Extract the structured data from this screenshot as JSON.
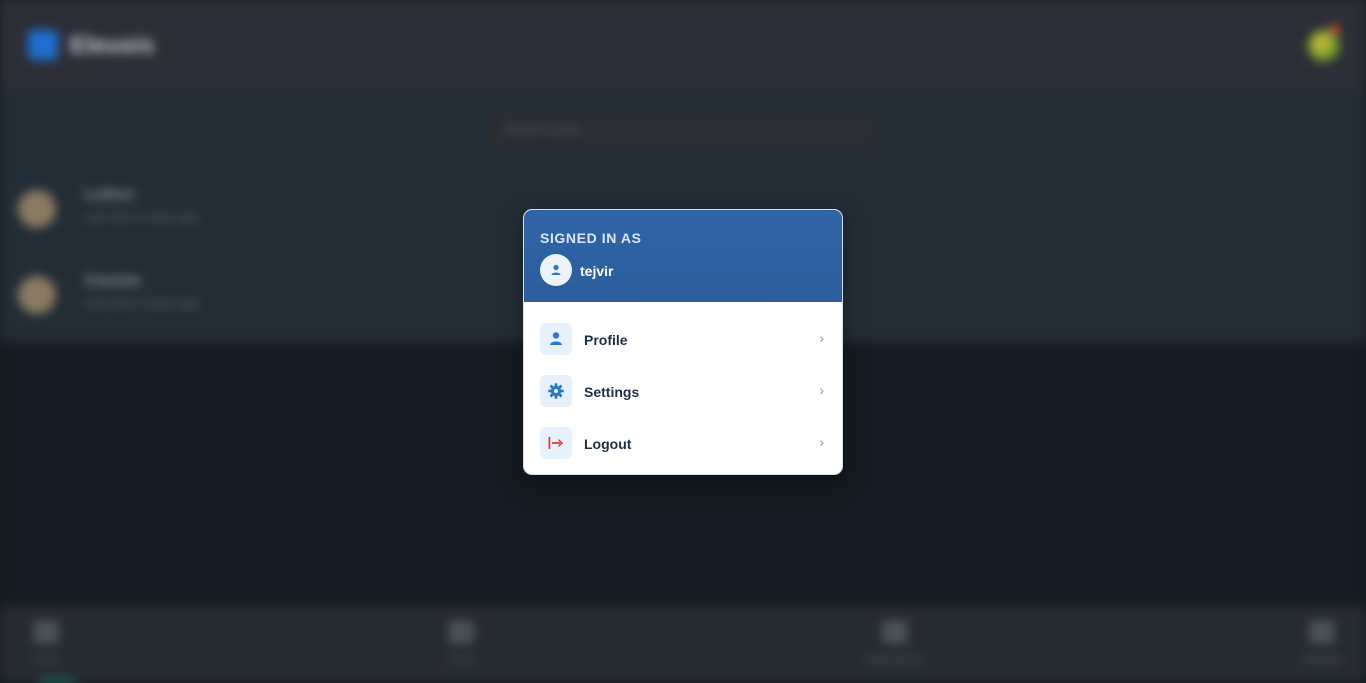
{
  "app": {
    "logo_text": "Eleusis",
    "search_placeholder": "Search users"
  },
  "contacts": [
    {
      "name": "Luthen",
      "subtitle": "Last seen 2 days ago"
    },
    {
      "name": "Cassian",
      "subtitle": "Last seen 5 days ago"
    }
  ],
  "bottom_nav": [
    {
      "label": "Home",
      "icon": "home-icon"
    },
    {
      "label": "Chats",
      "icon": "chat-icon"
    },
    {
      "label": "Notifications",
      "icon": "bell-icon"
    },
    {
      "label": "Settings",
      "icon": "gear-icon"
    }
  ],
  "menu": {
    "signed_in_label": "SIGNED IN AS",
    "username": "tejvir",
    "items": [
      {
        "label": "Profile",
        "icon": "user-icon"
      },
      {
        "label": "Settings",
        "icon": "gear-icon"
      },
      {
        "label": "Logout",
        "icon": "logout-icon"
      }
    ],
    "chevron": "›"
  },
  "colors": {
    "menu_header": "#2f65a8",
    "icon_blue": "#2b7bc4",
    "logout_red": "#e03a3a"
  }
}
